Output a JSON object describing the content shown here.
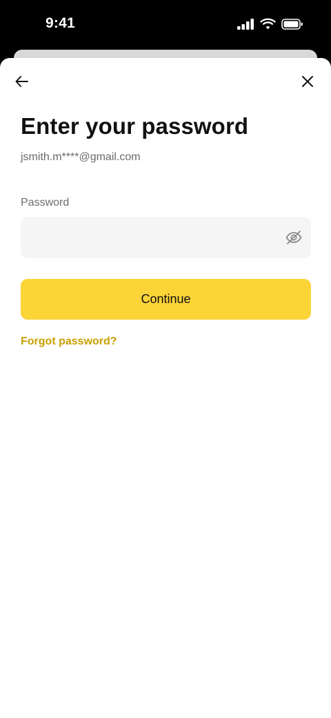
{
  "status_bar": {
    "time": "9:41"
  },
  "header": {
    "back_icon": "arrow-left-icon",
    "close_icon": "close-icon"
  },
  "main": {
    "title": "Enter your password",
    "email": "jsmith.m****@gmail.com",
    "password_label": "Password",
    "password_value": "",
    "visibility_icon": "eye-off-icon",
    "continue_label": "Continue",
    "forgot_label": "Forgot password?"
  },
  "colors": {
    "accent": "#fbd438",
    "link": "#c9a000",
    "field_background": "#f5f5f5"
  }
}
